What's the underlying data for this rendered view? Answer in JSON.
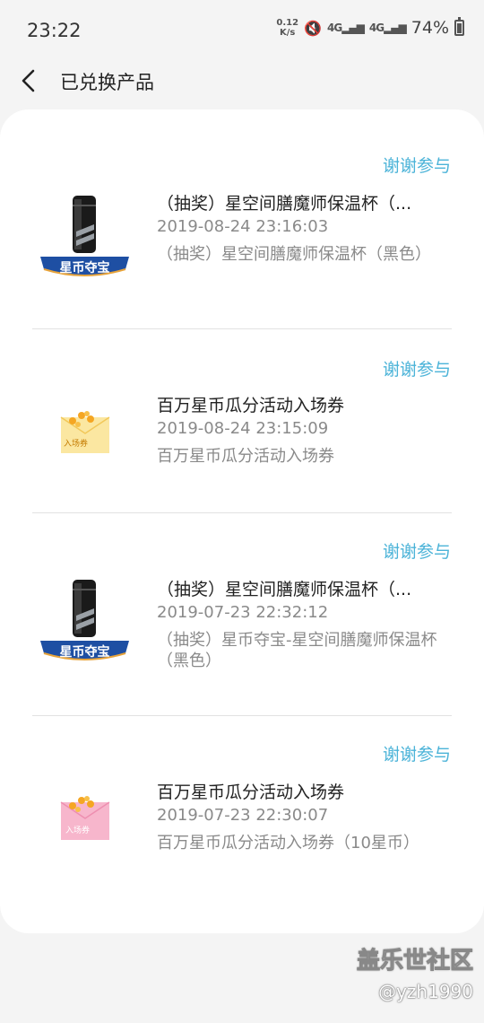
{
  "status_bar": {
    "time": "23:22",
    "net_speed_value": "0.12",
    "net_speed_unit": "K/s",
    "network": "4G",
    "battery": "74%"
  },
  "header": {
    "title": "已兑换产品"
  },
  "items": [
    {
      "status": "谢谢参与",
      "name": "（抽奖）星空间膳魔师保温杯（...",
      "time": "2019-08-24 23:16:03",
      "desc": "（抽奖）星空间膳魔师保温杯（黑色）",
      "thumb": {
        "type": "cup",
        "label": "星币夺宝"
      }
    },
    {
      "status": "谢谢参与",
      "name": "百万星币瓜分活动入场券",
      "time": "2019-08-24 23:15:09",
      "desc": "百万星币瓜分活动入场券",
      "thumb": {
        "type": "ticket",
        "label": "入场券",
        "color": "#fbe7a1"
      }
    },
    {
      "status": "谢谢参与",
      "name": "（抽奖）星空间膳魔师保温杯（...",
      "time": "2019-07-23 22:32:12",
      "desc": "（抽奖）星币夺宝-星空间膳魔师保温杯（黑色）",
      "thumb": {
        "type": "cup",
        "label": "星币夺宝"
      }
    },
    {
      "status": "谢谢参与",
      "name": "百万星币瓜分活动入场券",
      "time": "2019-07-23 22:30:07",
      "desc": "百万星币瓜分活动入场券（10星币）",
      "thumb": {
        "type": "ticket",
        "label": "入场券",
        "color": "#f7b6cc"
      }
    }
  ],
  "watermark": {
    "logo": "盖乐世社区",
    "user": "@yzh1990"
  },
  "colors": {
    "accent": "#4bb3d8",
    "badge_blue": "#1e4fa3"
  }
}
